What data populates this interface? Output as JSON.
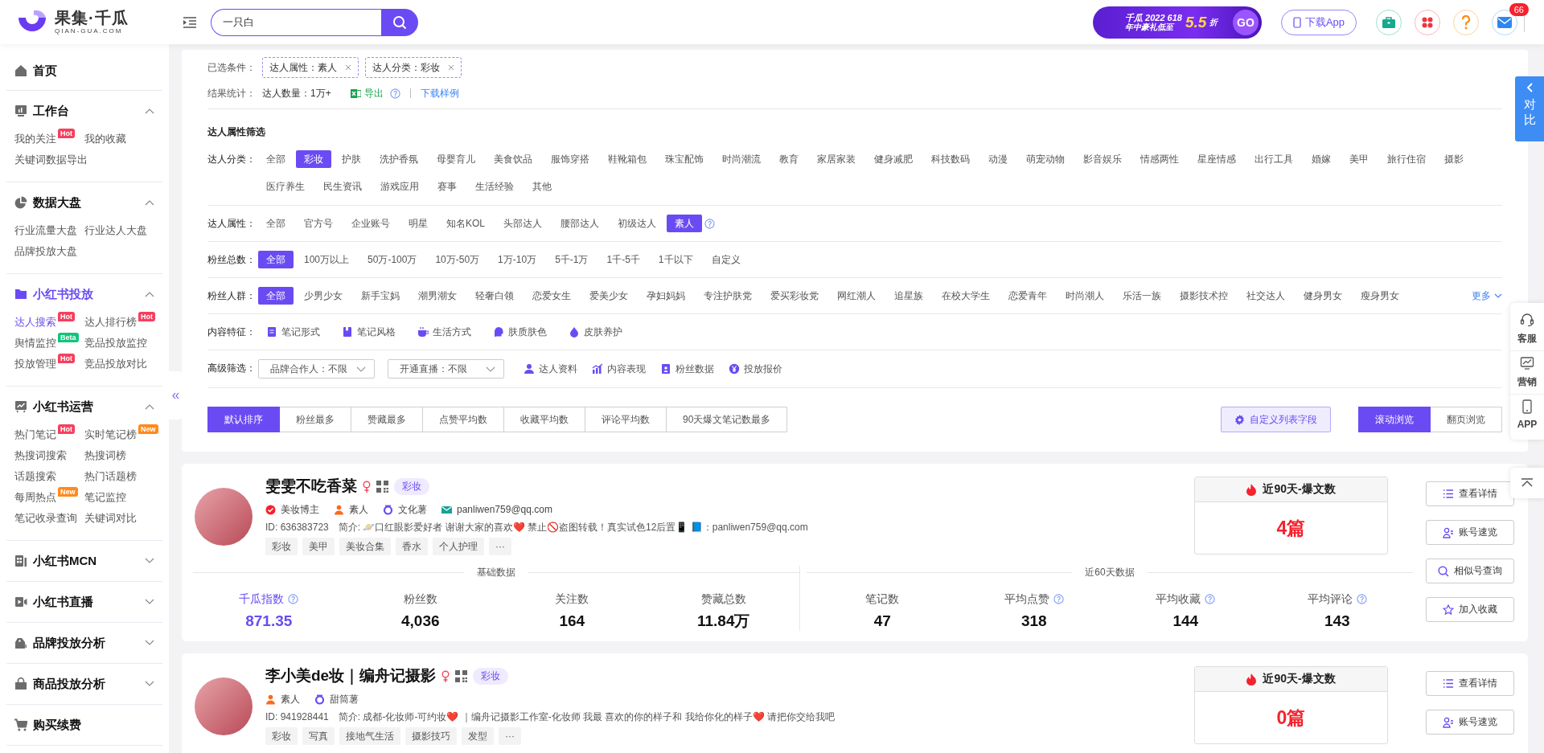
{
  "header": {
    "logo_name": "果集·千瓜",
    "logo_domain": "QIAN-GUA.COM",
    "search": {
      "value": "一只白"
    },
    "promo": {
      "title": "千瓜 2022 618",
      "subtitle": "年中豪礼低至",
      "discount": "5.5",
      "unit": "折",
      "go": "GO"
    },
    "app_button": "下载App",
    "mail_badge": "66"
  },
  "sidebar": {
    "sections": [
      {
        "kind": "link",
        "label": "首页"
      },
      {
        "kind": "group",
        "label": "工作台",
        "expanded": true,
        "active": false,
        "items": [
          {
            "label": "我的关注",
            "badge": "Hot",
            "color": "#f5405e",
            "selected": false
          },
          {
            "label": "我的收藏",
            "selected": false
          },
          {
            "label": "关键词数据导出",
            "selected": false
          }
        ]
      },
      {
        "kind": "group",
        "label": "数据大盘",
        "expanded": true,
        "active": false,
        "items": [
          {
            "label": "行业流量大盘",
            "selected": false
          },
          {
            "label": "行业达人大盘",
            "selected": false
          },
          {
            "label": "品牌投放大盘",
            "selected": false
          }
        ]
      },
      {
        "kind": "group",
        "label": "小红书投放",
        "expanded": true,
        "active": true,
        "items": [
          {
            "label": "达人搜索",
            "badge": "Hot",
            "color": "#f5405e",
            "selected": true
          },
          {
            "label": "达人排行榜",
            "badge": "Hot",
            "color": "#f5405e",
            "selected": false
          },
          {
            "label": "舆情监控",
            "badge": "Beta",
            "color": "#12c47a",
            "selected": false
          },
          {
            "label": "竞品投放监控",
            "selected": false
          },
          {
            "label": "投放管理",
            "badge": "Hot",
            "color": "#f5405e",
            "selected": false
          },
          {
            "label": "竞品投放对比",
            "selected": false
          }
        ]
      },
      {
        "kind": "group",
        "label": "小红书运营",
        "expanded": true,
        "active": false,
        "items": [
          {
            "label": "热门笔记",
            "badge": "Hot",
            "color": "#f5405e",
            "selected": false
          },
          {
            "label": "实时笔记榜",
            "badge": "New",
            "color": "#ff8a1c",
            "selected": false
          },
          {
            "label": "热搜词搜索",
            "selected": false
          },
          {
            "label": "热搜词榜",
            "selected": false
          },
          {
            "label": "话题搜索",
            "selected": false
          },
          {
            "label": "热门话题榜",
            "selected": false
          },
          {
            "label": "每周热点",
            "badge": "New",
            "color": "#ff8a1c",
            "selected": false
          },
          {
            "label": "笔记监控",
            "selected": false
          },
          {
            "label": "笔记收录查询",
            "selected": false
          },
          {
            "label": "关键词对比",
            "selected": false
          }
        ]
      },
      {
        "kind": "group",
        "label": "小红书MCN",
        "expanded": false,
        "active": false
      },
      {
        "kind": "group",
        "label": "小红书直播",
        "expanded": false,
        "active": false
      },
      {
        "kind": "group",
        "label": "品牌投放分析",
        "expanded": false,
        "active": false
      },
      {
        "kind": "group",
        "label": "商品投放分析",
        "expanded": false,
        "active": false
      },
      {
        "kind": "link",
        "label": "购买续费"
      }
    ]
  },
  "filters": {
    "selected_label": "已选条件：",
    "selected_tags": [
      "达人属性：素人",
      "达人分类：彩妆"
    ],
    "stats_label": "结果统计：",
    "result_count": "达人数量：1万+",
    "export": "导出",
    "sample_link": "下载样例",
    "title": "达人属性筛选",
    "rows": [
      {
        "kind": "options",
        "label": "达人分类：",
        "options": [
          {
            "label": "全部",
            "selected": false
          },
          {
            "label": "彩妆",
            "selected": true
          },
          {
            "label": "护肤",
            "selected": false
          },
          {
            "label": "洗护香氛",
            "selected": false
          },
          {
            "label": "母婴育儿",
            "selected": false
          },
          {
            "label": "美食饮品",
            "selected": false
          },
          {
            "label": "服饰穿搭",
            "selected": false
          },
          {
            "label": "鞋靴箱包",
            "selected": false
          },
          {
            "label": "珠宝配饰",
            "selected": false
          },
          {
            "label": "时尚潮流",
            "selected": false
          },
          {
            "label": "教育",
            "selected": false
          },
          {
            "label": "家居家装",
            "selected": false
          },
          {
            "label": "健身减肥",
            "selected": false
          },
          {
            "label": "科技数码",
            "selected": false
          },
          {
            "label": "动漫",
            "selected": false
          },
          {
            "label": "萌宠动物",
            "selected": false
          },
          {
            "label": "影音娱乐",
            "selected": false
          },
          {
            "label": "情感两性",
            "selected": false
          },
          {
            "label": "星座情感",
            "selected": false
          },
          {
            "label": "出行工具",
            "selected": false
          },
          {
            "label": "婚嫁",
            "selected": false
          },
          {
            "label": "美甲",
            "selected": false
          },
          {
            "label": "旅行住宿",
            "selected": false
          },
          {
            "label": "摄影",
            "selected": false
          },
          {
            "label": "医疗养生",
            "selected": false
          },
          {
            "label": "民生资讯",
            "selected": false
          },
          {
            "label": "游戏应用",
            "selected": false
          },
          {
            "label": "赛事",
            "selected": false
          },
          {
            "label": "生活经验",
            "selected": false
          },
          {
            "label": "其他",
            "selected": false
          }
        ]
      },
      {
        "kind": "options",
        "label": "达人属性：",
        "help": true,
        "options": [
          {
            "label": "全部",
            "selected": false
          },
          {
            "label": "官方号",
            "selected": false
          },
          {
            "label": "企业账号",
            "selected": false
          },
          {
            "label": "明星",
            "selected": false
          },
          {
            "label": "知名KOL",
            "selected": false
          },
          {
            "label": "头部达人",
            "selected": false
          },
          {
            "label": "腰部达人",
            "selected": false
          },
          {
            "label": "初级达人",
            "selected": false
          },
          {
            "label": "素人",
            "selected": true
          }
        ]
      },
      {
        "kind": "options",
        "label": "粉丝总数：",
        "options": [
          {
            "label": "全部",
            "selected": true
          },
          {
            "label": "100万以上",
            "selected": false
          },
          {
            "label": "50万-100万",
            "selected": false
          },
          {
            "label": "10万-50万",
            "selected": false
          },
          {
            "label": "1万-10万",
            "selected": false
          },
          {
            "label": "5千-1万",
            "selected": false
          },
          {
            "label": "1千-5千",
            "selected": false
          },
          {
            "label": "1千以下",
            "selected": false
          },
          {
            "label": "自定义",
            "selected": false
          }
        ]
      },
      {
        "kind": "options",
        "label": "粉丝人群：",
        "more": "更多",
        "options": [
          {
            "label": "全部",
            "selected": true
          },
          {
            "label": "少男少女",
            "selected": false
          },
          {
            "label": "新手宝妈",
            "selected": false
          },
          {
            "label": "潮男潮女",
            "selected": false
          },
          {
            "label": "轻奢白领",
            "selected": false
          },
          {
            "label": "恋爱女生",
            "selected": false
          },
          {
            "label": "爱美少女",
            "selected": false
          },
          {
            "label": "孕妇妈妈",
            "selected": false
          },
          {
            "label": "专注护肤党",
            "selected": false
          },
          {
            "label": "爱买彩妆党",
            "selected": false
          },
          {
            "label": "网红潮人",
            "selected": false
          },
          {
            "label": "追星族",
            "selected": false
          },
          {
            "label": "在校大学生",
            "selected": false
          },
          {
            "label": "恋爱青年",
            "selected": false
          },
          {
            "label": "时尚潮人",
            "selected": false
          },
          {
            "label": "乐活一族",
            "selected": false
          },
          {
            "label": "摄影技术控",
            "selected": false
          },
          {
            "label": "社交达人",
            "selected": false
          },
          {
            "label": "健身男女",
            "selected": false
          },
          {
            "label": "瘦身男女",
            "selected": false
          }
        ]
      },
      {
        "kind": "features",
        "label": "内容特征：",
        "links": [
          "笔记形式",
          "笔记风格",
          "生活方式",
          "肤质肤色",
          "皮肤养护"
        ]
      },
      {
        "kind": "advanced",
        "label": "高级筛选：",
        "selects": [
          "品牌合作人：不限",
          "开通直播：不限"
        ],
        "links": [
          "达人资料",
          "内容表现",
          "粉丝数据",
          "投放报价"
        ]
      }
    ],
    "sort_tabs": [
      {
        "label": "默认排序",
        "selected": true
      },
      {
        "label": "粉丝最多",
        "selected": false
      },
      {
        "label": "赞藏最多",
        "selected": false
      },
      {
        "label": "点赞平均数",
        "selected": false
      },
      {
        "label": "收藏平均数",
        "selected": false
      },
      {
        "label": "评论平均数",
        "selected": false
      },
      {
        "label": "90天爆文笔记数最多",
        "selected": false
      }
    ],
    "custom_fields_button": "自定义列表字段",
    "view_modes": [
      {
        "label": "滚动浏览",
        "selected": true
      },
      {
        "label": "翻页浏览",
        "selected": false
      }
    ]
  },
  "influencers": [
    {
      "name": "雯雯不吃香菜",
      "category": "彩妆",
      "badges": [
        {
          "kind": "verified",
          "label": "美妆博主"
        },
        {
          "kind": "person",
          "label": "素人"
        },
        {
          "kind": "level",
          "label": "文化薯"
        },
        {
          "kind": "email",
          "label": "panliwen759@qq.com"
        }
      ],
      "id_text": "ID: 636383723",
      "bio": "简介: 🪐口红眼影爱好者 谢谢大家的喜欢❤️ 禁止🚫盗图转载！真实试色12后置📱 📘：panliwen759@qq.com",
      "tags": [
        "彩妆",
        "美甲",
        "美妆合集",
        "香水",
        "个人护理"
      ],
      "more_tags": "···",
      "basic_title": "基础数据",
      "basic_stats": [
        {
          "label": "千瓜指数",
          "value": "871.35",
          "help": true,
          "highlight": true
        },
        {
          "label": "粉丝数",
          "value": "4,036"
        },
        {
          "label": "关注数",
          "value": "164"
        },
        {
          "label": "赞藏总数",
          "value": "11.84万"
        }
      ],
      "recent_title": "近60天数据",
      "recent_stats": [
        {
          "label": "笔记数",
          "value": "47"
        },
        {
          "label": "平均点赞",
          "value": "318",
          "help": true
        },
        {
          "label": "平均收藏",
          "value": "144",
          "help": true
        },
        {
          "label": "平均评论",
          "value": "143",
          "help": true
        }
      ],
      "viral": {
        "title": "近90天-爆文数",
        "value": "4篇"
      },
      "actions": [
        "查看详情",
        "账号速览",
        "相似号查询",
        "加入收藏"
      ]
    },
    {
      "name": "李小美de妆｜编舟记摄影",
      "category": "彩妆",
      "badges": [
        {
          "kind": "person",
          "label": "素人"
        },
        {
          "kind": "level",
          "label": "甜筒薯"
        }
      ],
      "id_text": "ID: 941928441",
      "bio": "简介: 成都-化妆师-可约妆❤️ ｜编舟记摄影工作室-化妆师 我最 喜欢的你的样子和 我给你化的样子❤️ 请把你交给我吧",
      "tags": [
        "彩妆",
        "写真",
        "接地气生活",
        "摄影技巧",
        "发型"
      ],
      "more_tags": "···",
      "viral": {
        "title": "近90天-爆文数",
        "value": "0篇"
      },
      "actions": [
        "查看详情",
        "账号速览"
      ]
    }
  ],
  "float_tools": {
    "compare": "对比",
    "items": [
      "客服",
      "营销",
      "APP"
    ]
  }
}
